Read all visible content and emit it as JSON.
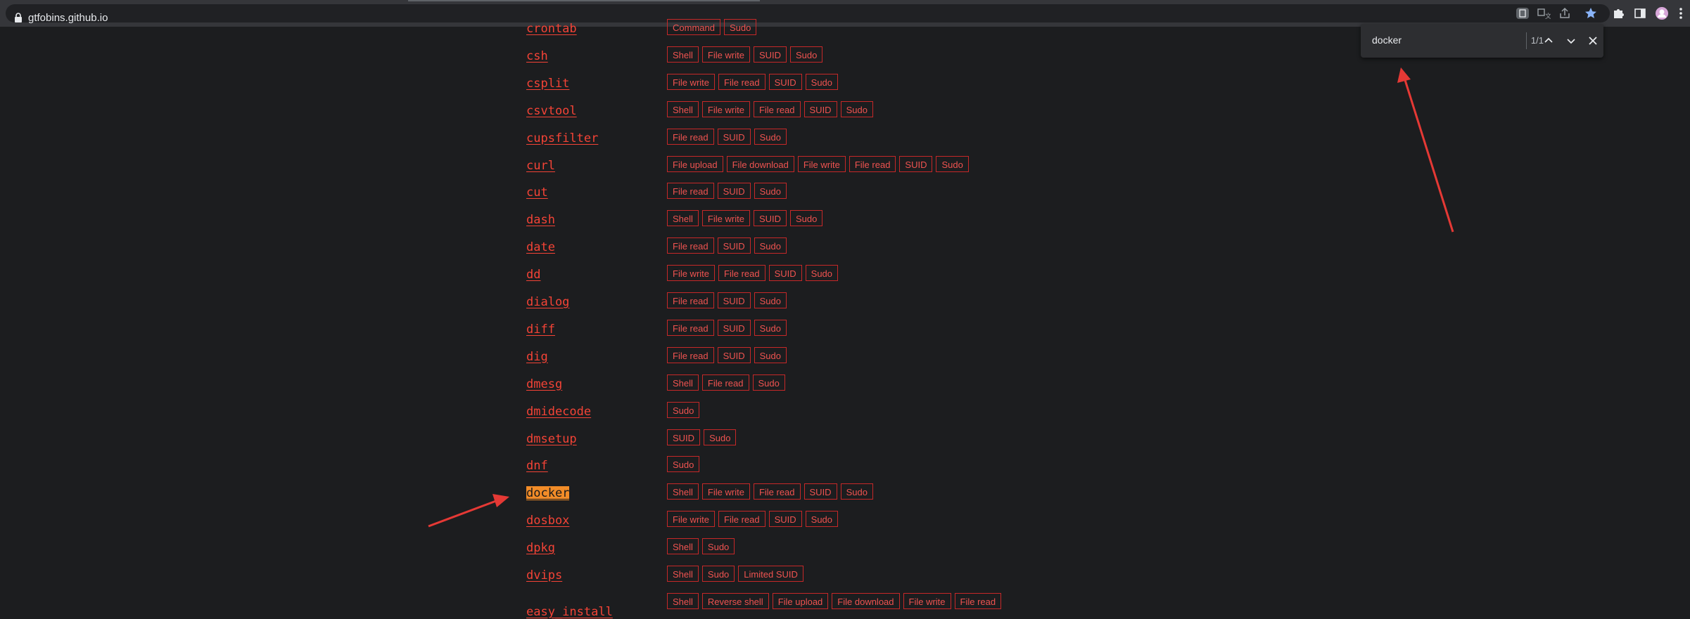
{
  "browser": {
    "url": "gtfobins.github.io"
  },
  "find": {
    "query": "docker",
    "count": "1/1"
  },
  "rows": [
    {
      "name": "crontab",
      "tags": [
        "Command",
        "Sudo"
      ]
    },
    {
      "name": "csh",
      "tags": [
        "Shell",
        "File write",
        "SUID",
        "Sudo"
      ]
    },
    {
      "name": "csplit",
      "tags": [
        "File write",
        "File read",
        "SUID",
        "Sudo"
      ]
    },
    {
      "name": "csvtool",
      "tags": [
        "Shell",
        "File write",
        "File read",
        "SUID",
        "Sudo"
      ]
    },
    {
      "name": "cupsfilter",
      "tags": [
        "File read",
        "SUID",
        "Sudo"
      ]
    },
    {
      "name": "curl",
      "tags": [
        "File upload",
        "File download",
        "File write",
        "File read",
        "SUID",
        "Sudo"
      ]
    },
    {
      "name": "cut",
      "tags": [
        "File read",
        "SUID",
        "Sudo"
      ]
    },
    {
      "name": "dash",
      "tags": [
        "Shell",
        "File write",
        "SUID",
        "Sudo"
      ]
    },
    {
      "name": "date",
      "tags": [
        "File read",
        "SUID",
        "Sudo"
      ]
    },
    {
      "name": "dd",
      "tags": [
        "File write",
        "File read",
        "SUID",
        "Sudo"
      ]
    },
    {
      "name": "dialog",
      "tags": [
        "File read",
        "SUID",
        "Sudo"
      ]
    },
    {
      "name": "diff",
      "tags": [
        "File read",
        "SUID",
        "Sudo"
      ]
    },
    {
      "name": "dig",
      "tags": [
        "File read",
        "SUID",
        "Sudo"
      ]
    },
    {
      "name": "dmesg",
      "tags": [
        "Shell",
        "File read",
        "Sudo"
      ]
    },
    {
      "name": "dmidecode",
      "tags": [
        "Sudo"
      ]
    },
    {
      "name": "dmsetup",
      "tags": [
        "SUID",
        "Sudo"
      ]
    },
    {
      "name": "dnf",
      "tags": [
        "Sudo"
      ]
    },
    {
      "name": "docker",
      "highlight": true,
      "tags": [
        "Shell",
        "File write",
        "File read",
        "SUID",
        "Sudo"
      ]
    },
    {
      "name": "dosbox",
      "tags": [
        "File write",
        "File read",
        "SUID",
        "Sudo"
      ]
    },
    {
      "name": "dpkg",
      "tags": [
        "Shell",
        "Sudo"
      ]
    },
    {
      "name": "dvips",
      "tags": [
        "Shell",
        "Sudo",
        "Limited SUID"
      ]
    },
    {
      "name": "easy_install",
      "tags": [
        "Shell",
        "Reverse shell",
        "File upload",
        "File download",
        "File write",
        "File read"
      ]
    }
  ],
  "colors": {
    "accent_red": "#f44336",
    "highlight_orange": "#f28c28",
    "annotation_arrow": "#e53935"
  }
}
